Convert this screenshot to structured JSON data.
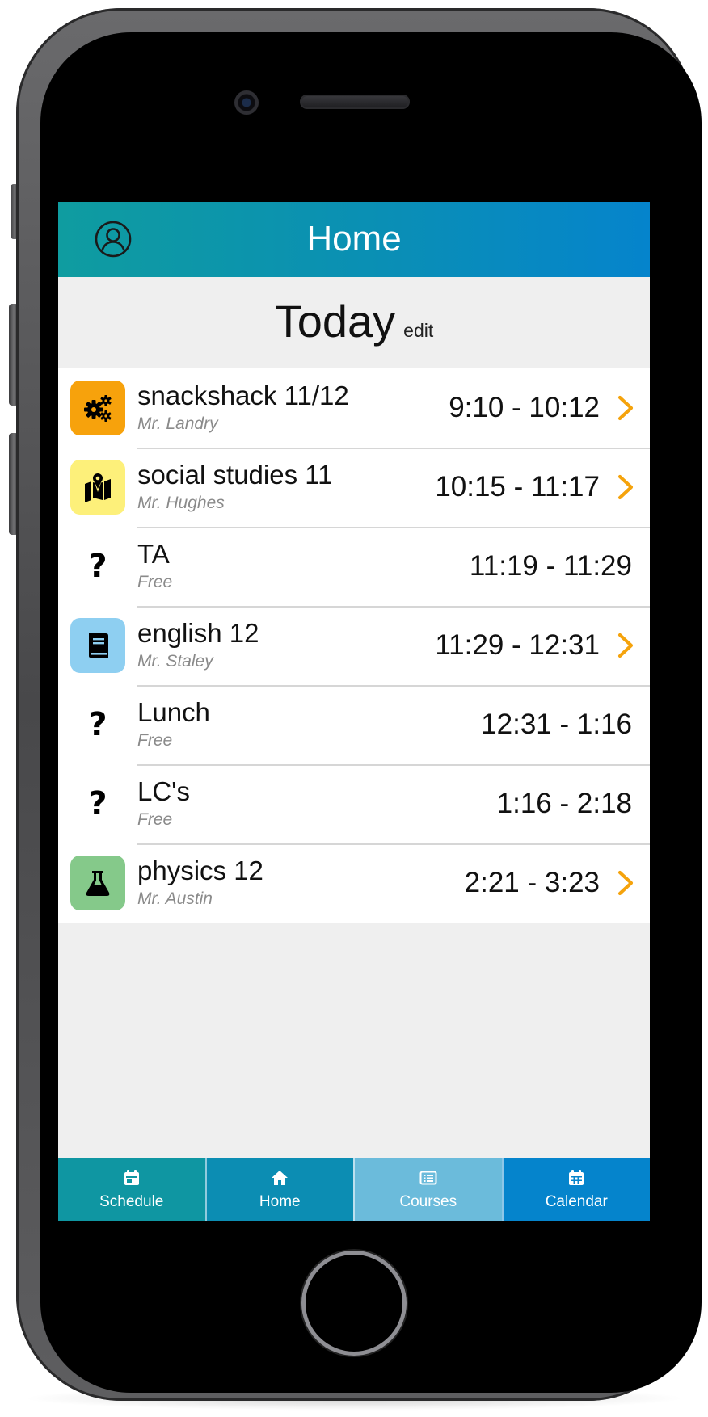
{
  "header": {
    "title": "Home",
    "gradient": [
      "#0f9ca0",
      "#0584cc"
    ]
  },
  "today": {
    "title": "Today",
    "edit_label": "edit"
  },
  "schedule": [
    {
      "name": "snackshack 11/12",
      "teacher": "Mr. Landry",
      "time": "9:10 - 10:12",
      "icon": "gears-icon",
      "icon_bg": "#f7a20c",
      "has_chevron": true
    },
    {
      "name": "social studies 11",
      "teacher": "Mr. Hughes",
      "time": "10:15 - 11:17",
      "icon": "map-icon",
      "icon_bg": "#fdf07a",
      "has_chevron": true
    },
    {
      "name": "TA",
      "teacher": "Free",
      "time": "11:19 - 11:29",
      "icon": "question-icon",
      "icon_bg": "transparent",
      "has_chevron": false
    },
    {
      "name": "english 12",
      "teacher": "Mr. Staley",
      "time": "11:29 - 12:31",
      "icon": "book-icon",
      "icon_bg": "#8ecff1",
      "has_chevron": true
    },
    {
      "name": "Lunch",
      "teacher": "Free",
      "time": "12:31 - 1:16",
      "icon": "question-icon",
      "icon_bg": "transparent",
      "has_chevron": false
    },
    {
      "name": "LC's",
      "teacher": "Free",
      "time": "1:16 - 2:18",
      "icon": "question-icon",
      "icon_bg": "transparent",
      "has_chevron": false
    },
    {
      "name": "physics 12",
      "teacher": "Mr. Austin",
      "time": "2:21 - 3:23",
      "icon": "flask-icon",
      "icon_bg": "#85c98a",
      "has_chevron": true
    }
  ],
  "chevron_color": "#f5a30c",
  "tabs": [
    {
      "label": "Schedule",
      "icon": "calendar-day-icon",
      "bg": "#0f96a2",
      "active": false
    },
    {
      "label": "Home",
      "icon": "home-icon",
      "bg": "#0c8db3",
      "active": false
    },
    {
      "label": "Courses",
      "icon": "list-icon",
      "bg": "#6bbbdb",
      "active": true
    },
    {
      "label": "Calendar",
      "icon": "calendar-icon",
      "bg": "#0584cc",
      "active": false
    }
  ]
}
